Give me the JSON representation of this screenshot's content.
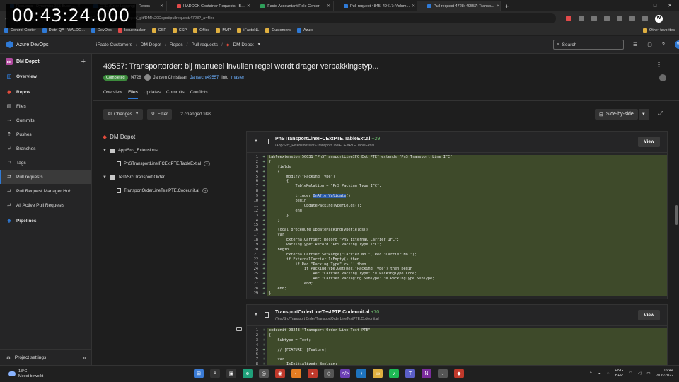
{
  "timer": "00:43:24.000",
  "browser": {
    "tabs": [
      {
        "title": "Requests - Dynamics 365 Busin...",
        "color": "#2f7ad6",
        "active": false
      },
      {
        "title": "CRE (Error Logging) - Repos",
        "color": "#2f7ad6",
        "active": false
      },
      {
        "title": "HADOCK Container Requests - B...",
        "color": "#e24a4a",
        "active": false
      },
      {
        "title": "iFacto Accountant Role Center",
        "color": "#2f9e5a",
        "active": false
      },
      {
        "title": "Pull request 4845: 49417: Volum...",
        "color": "#2f7ad6",
        "active": false
      },
      {
        "title": "Pull request 4728: 49557: Transp...",
        "color": "#2f7ad6",
        "active": true
      }
    ],
    "new_tab": "+",
    "url": "dev.azure.com/ifacto%20Customers/DM%20Depot/_git/DM%20Depot/pullrequest/4728?_a=files",
    "bookmarks": [
      "Control Center",
      "Distri QA - WALDO...",
      "DevOps",
      "Issuetracker",
      "CSF",
      "CSP",
      "Office",
      "MVP",
      "iFactoNL",
      "Customers",
      "Azure"
    ],
    "other_favorites": "Other favorites",
    "profile": "W"
  },
  "header": {
    "product": "Azure DevOps",
    "breadcrumbs": [
      "iFacto Customers",
      "DM Depot",
      "Repos",
      "Pull requests",
      "DM Depot"
    ],
    "search_placeholder": "Search",
    "user_initial": "W"
  },
  "sidebar": {
    "project": "DM Depot",
    "project_badge": "DD",
    "items": [
      {
        "label": "Overview",
        "icon": "overview-icon",
        "section": true
      },
      {
        "label": "Repos",
        "icon": "repos-icon",
        "section": true
      },
      {
        "label": "Files",
        "icon": "files-icon"
      },
      {
        "label": "Commits",
        "icon": "commits-icon"
      },
      {
        "label": "Pushes",
        "icon": "pushes-icon"
      },
      {
        "label": "Branches",
        "icon": "branches-icon"
      },
      {
        "label": "Tags",
        "icon": "tags-icon"
      },
      {
        "label": "Pull requests",
        "icon": "pull-requests-icon",
        "selected": true
      },
      {
        "label": "Pull Request Manager Hub",
        "icon": "hub-icon"
      },
      {
        "label": "All Active Pull Requests",
        "icon": "active-prs-icon"
      },
      {
        "label": "Pipelines",
        "icon": "pipelines-icon",
        "section": true
      }
    ],
    "footer": "Project settings"
  },
  "pr": {
    "title": "49557: Transportorder: bij manueel invullen regel wordt drager verpakkingstyp...",
    "status": "Completed",
    "id": "!4728",
    "author": "Jansen Christiaan",
    "source_branch": "Jansech/49557",
    "into": "into",
    "target_branch": "master",
    "tabs": [
      "Overview",
      "Files",
      "Updates",
      "Commits",
      "Conflicts"
    ],
    "active_tab": "Files"
  },
  "toolbar": {
    "all_changes": "All Changes",
    "filter": "Filter",
    "changed_files": "2 changed files",
    "side_by_side": "Side-by-side"
  },
  "tree": {
    "root": "DM Depot",
    "folder1": "App/Src/_Extensions",
    "file1": "PnSTransportLineIFCExtPTE.TableExt.al",
    "folder2": "Test/Src/Transport Order",
    "file2": "TransportOrderLineTestPTE.Codeunit.al"
  },
  "files": [
    {
      "name": "PnSTransportLineIFCExtPTE.TableExt.al",
      "added": "+29",
      "path": "/App/Src/_Extensions/PnSTransportLineIFCExtPTE.TableExt.al",
      "view": "View",
      "lines": [
        "tableextension 50031 \"PnSTransportLineIFC Ext PTE\" extends \"PnS Transport Line IFC\"",
        "{",
        "    fields",
        "    {",
        "        modify(\"Packing Type\")",
        "        {",
        "            TableRelation = \"PnS Packing Type IFC\";",
        "",
        "            trigger OnAfterValidate()",
        "            begin",
        "                UpdatePackingTypeFields();",
        "            end;",
        "        }",
        "    }",
        "",
        "    local procedure UpdatePackingTypeFields()",
        "    var",
        "        ExternalCarrier: Record \"PnS External Carrier IFC\";",
        "        PackingType: Record \"PnS Packing Type IFC\";",
        "    begin",
        "        ExternalCarrier.SetRange(\"Carrier No.\", Rec.\"Carrier No.\");",
        "        if ExternalCarrier.IsEmpty() then",
        "            if Rec.\"Packing Type\" <> '' then",
        "                if PackingType.Get(Rec.\"Packing Type\") then begin",
        "                    Rec.\"Carrier Packing Type\" := PackingType.Code;",
        "                    Rec.\"Carrier Packaging SubType\" := PackingType.SubType;",
        "                end;",
        "    end;",
        "}"
      ]
    },
    {
      "name": "TransportOrderLineTestPTE.Codeunit.al",
      "added": "+70",
      "path": "/Test/Src/Transport Order/TransportOrderLineTestPTE.Codeunit.al",
      "view": "View",
      "lines": [
        "codeunit 93248 \"Transport Order Line Test PTE\"",
        "{",
        "    Subtype = Test;",
        "",
        "    // [FEATURE] [Feature]",
        "",
        "    var",
        "        IsInitialized: Boolean;"
      ]
    }
  ],
  "taskbar": {
    "temp": "18°C",
    "weather": "Meest bewolkt",
    "lang1": "ENG",
    "lang2": "BEP",
    "time": "16:44",
    "date": "7/06/2022"
  }
}
